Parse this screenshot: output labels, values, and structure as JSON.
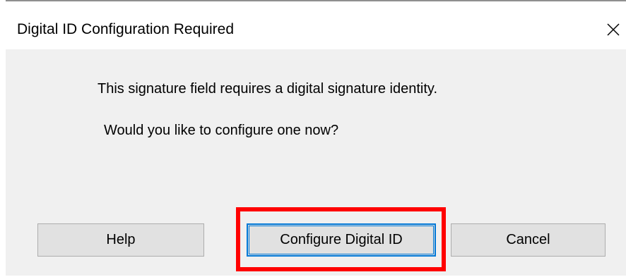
{
  "window": {
    "title": "Digital ID Configuration Required",
    "close_icon": "close-icon"
  },
  "message": {
    "line1": "This signature field requires a digital signature identity.",
    "line2": "Would you like to configure one now?"
  },
  "buttons": {
    "help": "Help",
    "configure": "Configure Digital ID",
    "cancel": "Cancel"
  },
  "colors": {
    "highlight": "#ff0000",
    "focus_border": "#0078d7",
    "button_face": "#e1e1e1",
    "client_background": "#f0f0f0"
  }
}
